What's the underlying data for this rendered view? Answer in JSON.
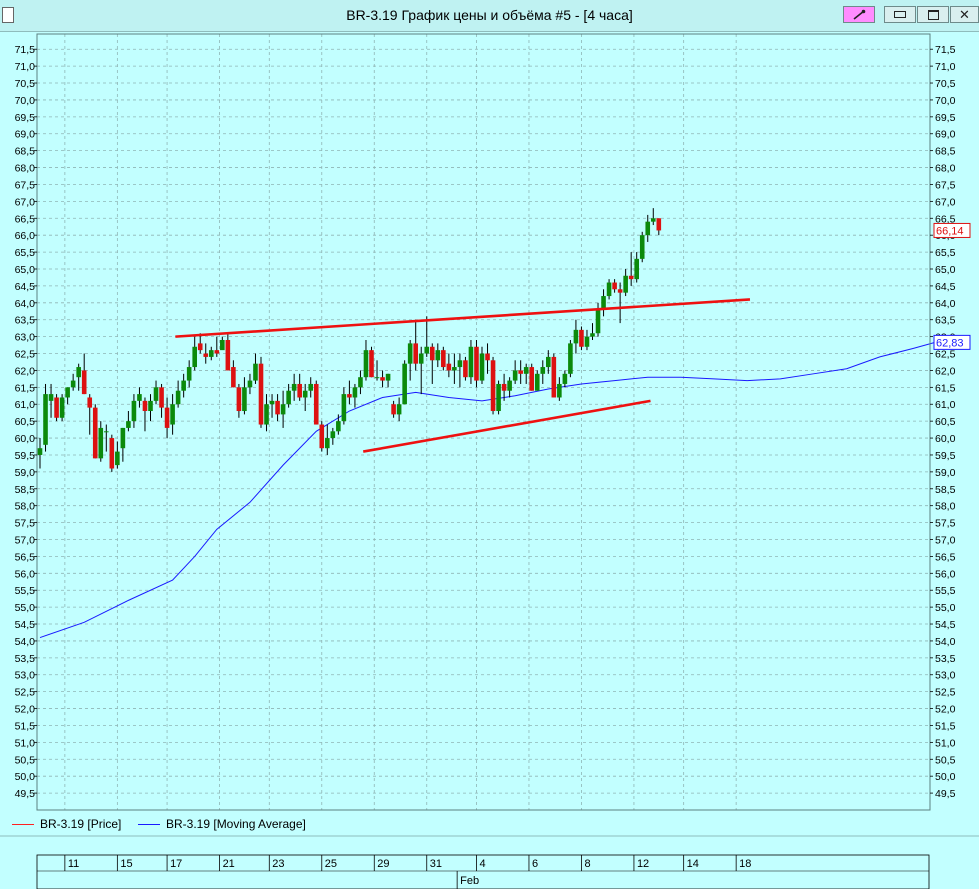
{
  "window": {
    "title": "BR-3.19 График цены и объёма #5 - [4 часа]",
    "close_glyph": "✕"
  },
  "legend": {
    "items": [
      {
        "label": "BR-3.19 [Price]",
        "color": "#ff2020"
      },
      {
        "label": "BR-3.19 [Moving Average]",
        "color": "#1a1aff"
      }
    ]
  },
  "colors": {
    "background": "#c2ffff",
    "up_candle": "#0b8a0b",
    "down_candle": "#dd1111",
    "wick": "#000000",
    "grid": "#8fb5b5",
    "trendline": "#ee1111",
    "ma_line": "#1a1aff"
  },
  "chart_data": {
    "type": "candlestick",
    "ylim": [
      49,
      71.95
    ],
    "grid": true,
    "y_ticks": [
      49.5,
      50,
      50.5,
      51,
      51.5,
      52,
      52.5,
      53,
      53.5,
      54,
      54.5,
      55,
      55.5,
      56,
      56.5,
      57,
      57.5,
      58,
      58.5,
      59,
      59.5,
      60,
      60.5,
      61,
      61.5,
      62,
      62.5,
      63,
      63.5,
      64,
      64.5,
      65,
      65.5,
      66,
      66.5,
      67,
      67.5,
      68,
      68.5,
      69,
      69.5,
      70,
      70.5,
      71,
      71.5
    ],
    "x_ticks": [
      "11",
      "15",
      "17",
      "21",
      "23",
      "25",
      "29",
      "31",
      "4",
      "6",
      "8",
      "12",
      "14",
      "18"
    ],
    "x_tick_positions": [
      5,
      14.5,
      23.5,
      33,
      42,
      51.5,
      61,
      70.5,
      79.5,
      89,
      98.5,
      108,
      117,
      126.5
    ],
    "month_label": "Feb",
    "month_position": 76,
    "candles": [
      [
        59.5,
        60.0,
        59.1,
        59.7
      ],
      [
        59.8,
        61.6,
        59.6,
        61.3
      ],
      [
        61.1,
        61.6,
        60.6,
        61.3
      ],
      [
        61.2,
        61.3,
        60.5,
        60.6
      ],
      [
        60.6,
        61.3,
        60.5,
        61.2
      ],
      [
        61.2,
        61.5,
        61.0,
        61.5
      ],
      [
        61.5,
        61.9,
        61.4,
        61.7
      ],
      [
        61.8,
        62.2,
        61.4,
        62.1
      ],
      [
        62.0,
        62.5,
        61.3,
        61.3
      ],
      [
        61.2,
        61.3,
        60.1,
        60.9
      ],
      [
        60.9,
        61.0,
        59.4,
        59.4
      ],
      [
        59.4,
        60.5,
        59.3,
        60.3
      ],
      [
        60.2,
        60.4,
        59.6,
        60.2
      ],
      [
        60.0,
        60.1,
        59.0,
        59.1
      ],
      [
        59.2,
        59.9,
        59.1,
        59.6
      ],
      [
        59.7,
        60.3,
        59.3,
        60.3
      ],
      [
        60.3,
        60.8,
        60.2,
        60.5
      ],
      [
        60.5,
        61.3,
        60.3,
        61.1
      ],
      [
        61.1,
        61.5,
        60.9,
        61.3
      ],
      [
        61.1,
        61.2,
        60.2,
        60.8
      ],
      [
        60.8,
        61.3,
        60.5,
        61.1
      ],
      [
        61.1,
        61.7,
        61.0,
        61.5
      ],
      [
        61.5,
        61.6,
        60.6,
        60.9
      ],
      [
        60.9,
        61.2,
        60.0,
        60.3
      ],
      [
        60.4,
        61.3,
        60.1,
        61.0
      ],
      [
        61.0,
        61.7,
        60.9,
        61.4
      ],
      [
        61.4,
        61.9,
        61.2,
        61.7
      ],
      [
        61.7,
        62.3,
        61.5,
        62.1
      ],
      [
        62.1,
        63.0,
        62.0,
        62.7
      ],
      [
        62.8,
        63.1,
        62.5,
        62.6
      ],
      [
        62.5,
        62.8,
        62.2,
        62.4
      ],
      [
        62.4,
        62.7,
        62.3,
        62.6
      ],
      [
        62.6,
        63.0,
        62.4,
        62.5
      ],
      [
        62.6,
        63.0,
        62.7,
        62.9
      ],
      [
        62.9,
        63.1,
        62.0,
        62.0
      ],
      [
        62.1,
        62.3,
        61.5,
        61.5
      ],
      [
        61.5,
        61.6,
        60.6,
        60.8
      ],
      [
        60.8,
        61.8,
        60.7,
        61.5
      ],
      [
        61.5,
        61.9,
        61.3,
        61.7
      ],
      [
        61.7,
        62.5,
        61.6,
        62.2
      ],
      [
        62.2,
        62.4,
        60.3,
        60.4
      ],
      [
        60.4,
        61.3,
        60.2,
        61.0
      ],
      [
        61.0,
        61.3,
        60.6,
        61.1
      ],
      [
        61.1,
        61.3,
        60.5,
        60.7
      ],
      [
        60.7,
        61.4,
        60.3,
        61.0
      ],
      [
        61.0,
        61.6,
        60.9,
        61.4
      ],
      [
        61.4,
        61.9,
        61.1,
        61.6
      ],
      [
        61.6,
        61.9,
        61.1,
        61.2
      ],
      [
        61.2,
        61.6,
        60.8,
        61.4
      ],
      [
        61.4,
        61.8,
        61.2,
        61.6
      ],
      [
        61.6,
        61.7,
        60.4,
        60.4
      ],
      [
        60.4,
        60.5,
        59.6,
        59.7
      ],
      [
        59.7,
        60.4,
        59.5,
        60.0
      ],
      [
        60.0,
        60.3,
        59.8,
        60.2
      ],
      [
        60.2,
        60.7,
        60.1,
        60.5
      ],
      [
        60.5,
        61.5,
        60.4,
        61.3
      ],
      [
        61.3,
        61.7,
        61.0,
        61.2
      ],
      [
        61.2,
        61.6,
        60.9,
        61.5
      ],
      [
        61.5,
        62.0,
        61.3,
        61.8
      ],
      [
        61.8,
        62.9,
        61.7,
        62.6
      ],
      [
        62.6,
        62.7,
        61.8,
        61.8
      ],
      [
        61.8,
        62.3,
        61.7,
        61.8
      ],
      [
        61.8,
        62.0,
        61.5,
        61.7
      ],
      [
        61.7,
        61.9,
        61.5,
        61.9
      ],
      [
        61.0,
        61.1,
        60.6,
        60.7
      ],
      [
        60.7,
        61.2,
        60.5,
        61.0
      ],
      [
        61.0,
        62.3,
        61.0,
        62.2
      ],
      [
        62.2,
        62.9,
        61.7,
        62.8
      ],
      [
        62.8,
        63.5,
        62.0,
        62.2
      ],
      [
        62.2,
        62.7,
        61.3,
        62.5
      ],
      [
        62.5,
        63.6,
        62.4,
        62.7
      ],
      [
        62.7,
        62.8,
        61.6,
        62.3
      ],
      [
        62.3,
        62.8,
        62.1,
        62.6
      ],
      [
        62.6,
        62.7,
        62.0,
        62.1
      ],
      [
        62.2,
        62.5,
        61.8,
        62.0
      ],
      [
        62.0,
        62.5,
        61.6,
        62.1
      ],
      [
        62.1,
        62.5,
        61.5,
        62.3
      ],
      [
        62.3,
        62.4,
        61.7,
        61.8
      ],
      [
        61.8,
        62.9,
        61.6,
        62.7
      ],
      [
        62.7,
        62.9,
        61.5,
        61.7
      ],
      [
        61.7,
        62.7,
        61.6,
        62.5
      ],
      [
        62.5,
        62.8,
        61.9,
        62.3
      ],
      [
        62.3,
        62.4,
        60.7,
        60.8
      ],
      [
        60.8,
        61.7,
        60.7,
        61.6
      ],
      [
        61.6,
        61.9,
        61.1,
        61.4
      ],
      [
        61.4,
        61.8,
        61.2,
        61.7
      ],
      [
        61.7,
        62.3,
        61.6,
        62.0
      ],
      [
        62.0,
        62.3,
        61.6,
        61.9
      ],
      [
        61.9,
        62.2,
        61.6,
        62.1
      ],
      [
        62.1,
        62.2,
        61.4,
        61.4
      ],
      [
        61.4,
        62.0,
        61.4,
        61.9
      ],
      [
        61.9,
        62.3,
        61.6,
        62.1
      ],
      [
        62.1,
        62.6,
        61.9,
        62.4
      ],
      [
        62.4,
        62.5,
        61.2,
        61.2
      ],
      [
        61.2,
        61.8,
        61.1,
        61.6
      ],
      [
        61.6,
        62.0,
        61.5,
        61.9
      ],
      [
        61.9,
        62.9,
        61.8,
        62.8
      ],
      [
        62.8,
        63.5,
        62.5,
        63.2
      ],
      [
        63.2,
        63.3,
        62.6,
        62.7
      ],
      [
        62.7,
        63.2,
        62.6,
        63.0
      ],
      [
        63.0,
        63.4,
        62.9,
        63.1
      ],
      [
        63.1,
        64.0,
        63.0,
        63.8
      ],
      [
        63.8,
        64.4,
        63.6,
        64.2
      ],
      [
        64.2,
        64.7,
        64.1,
        64.6
      ],
      [
        64.6,
        64.7,
        64.3,
        64.4
      ],
      [
        64.4,
        64.6,
        63.4,
        64.3
      ],
      [
        64.3,
        65.0,
        64.2,
        64.8
      ],
      [
        64.8,
        65.5,
        64.5,
        64.7
      ],
      [
        64.7,
        65.5,
        64.6,
        65.3
      ],
      [
        65.3,
        66.1,
        65.2,
        66.0
      ],
      [
        66.0,
        66.6,
        65.8,
        66.4
      ],
      [
        66.4,
        66.8,
        66.3,
        66.5
      ],
      [
        66.5,
        66.5,
        66.0,
        66.14
      ]
    ],
    "moving_average": [
      [
        0,
        54.1
      ],
      [
        8,
        54.55
      ],
      [
        16,
        55.2
      ],
      [
        24,
        55.8
      ],
      [
        28,
        56.5
      ],
      [
        32,
        57.3
      ],
      [
        38,
        58.1
      ],
      [
        44,
        59.2
      ],
      [
        50,
        60.2
      ],
      [
        56,
        60.8
      ],
      [
        62,
        61.2
      ],
      [
        68,
        61.35
      ],
      [
        74,
        61.2
      ],
      [
        80,
        61.1
      ],
      [
        86,
        61.25
      ],
      [
        92,
        61.45
      ],
      [
        98,
        61.6
      ],
      [
        104,
        61.7
      ],
      [
        110,
        61.8
      ],
      [
        116,
        61.8
      ],
      [
        122,
        61.75
      ],
      [
        128,
        61.7
      ],
      [
        134,
        61.75
      ],
      [
        140,
        61.9
      ],
      [
        146,
        62.05
      ],
      [
        152,
        62.4
      ],
      [
        158,
        62.65
      ],
      [
        162,
        62.83
      ]
    ],
    "trendlines": [
      {
        "from": [
          24.5,
          63.0
        ],
        "to": [
          128.5,
          64.1
        ]
      },
      {
        "from": [
          58.5,
          59.6
        ],
        "to": [
          110.5,
          61.1
        ]
      }
    ],
    "last_price": "66,14",
    "last_ma": "62,83"
  }
}
